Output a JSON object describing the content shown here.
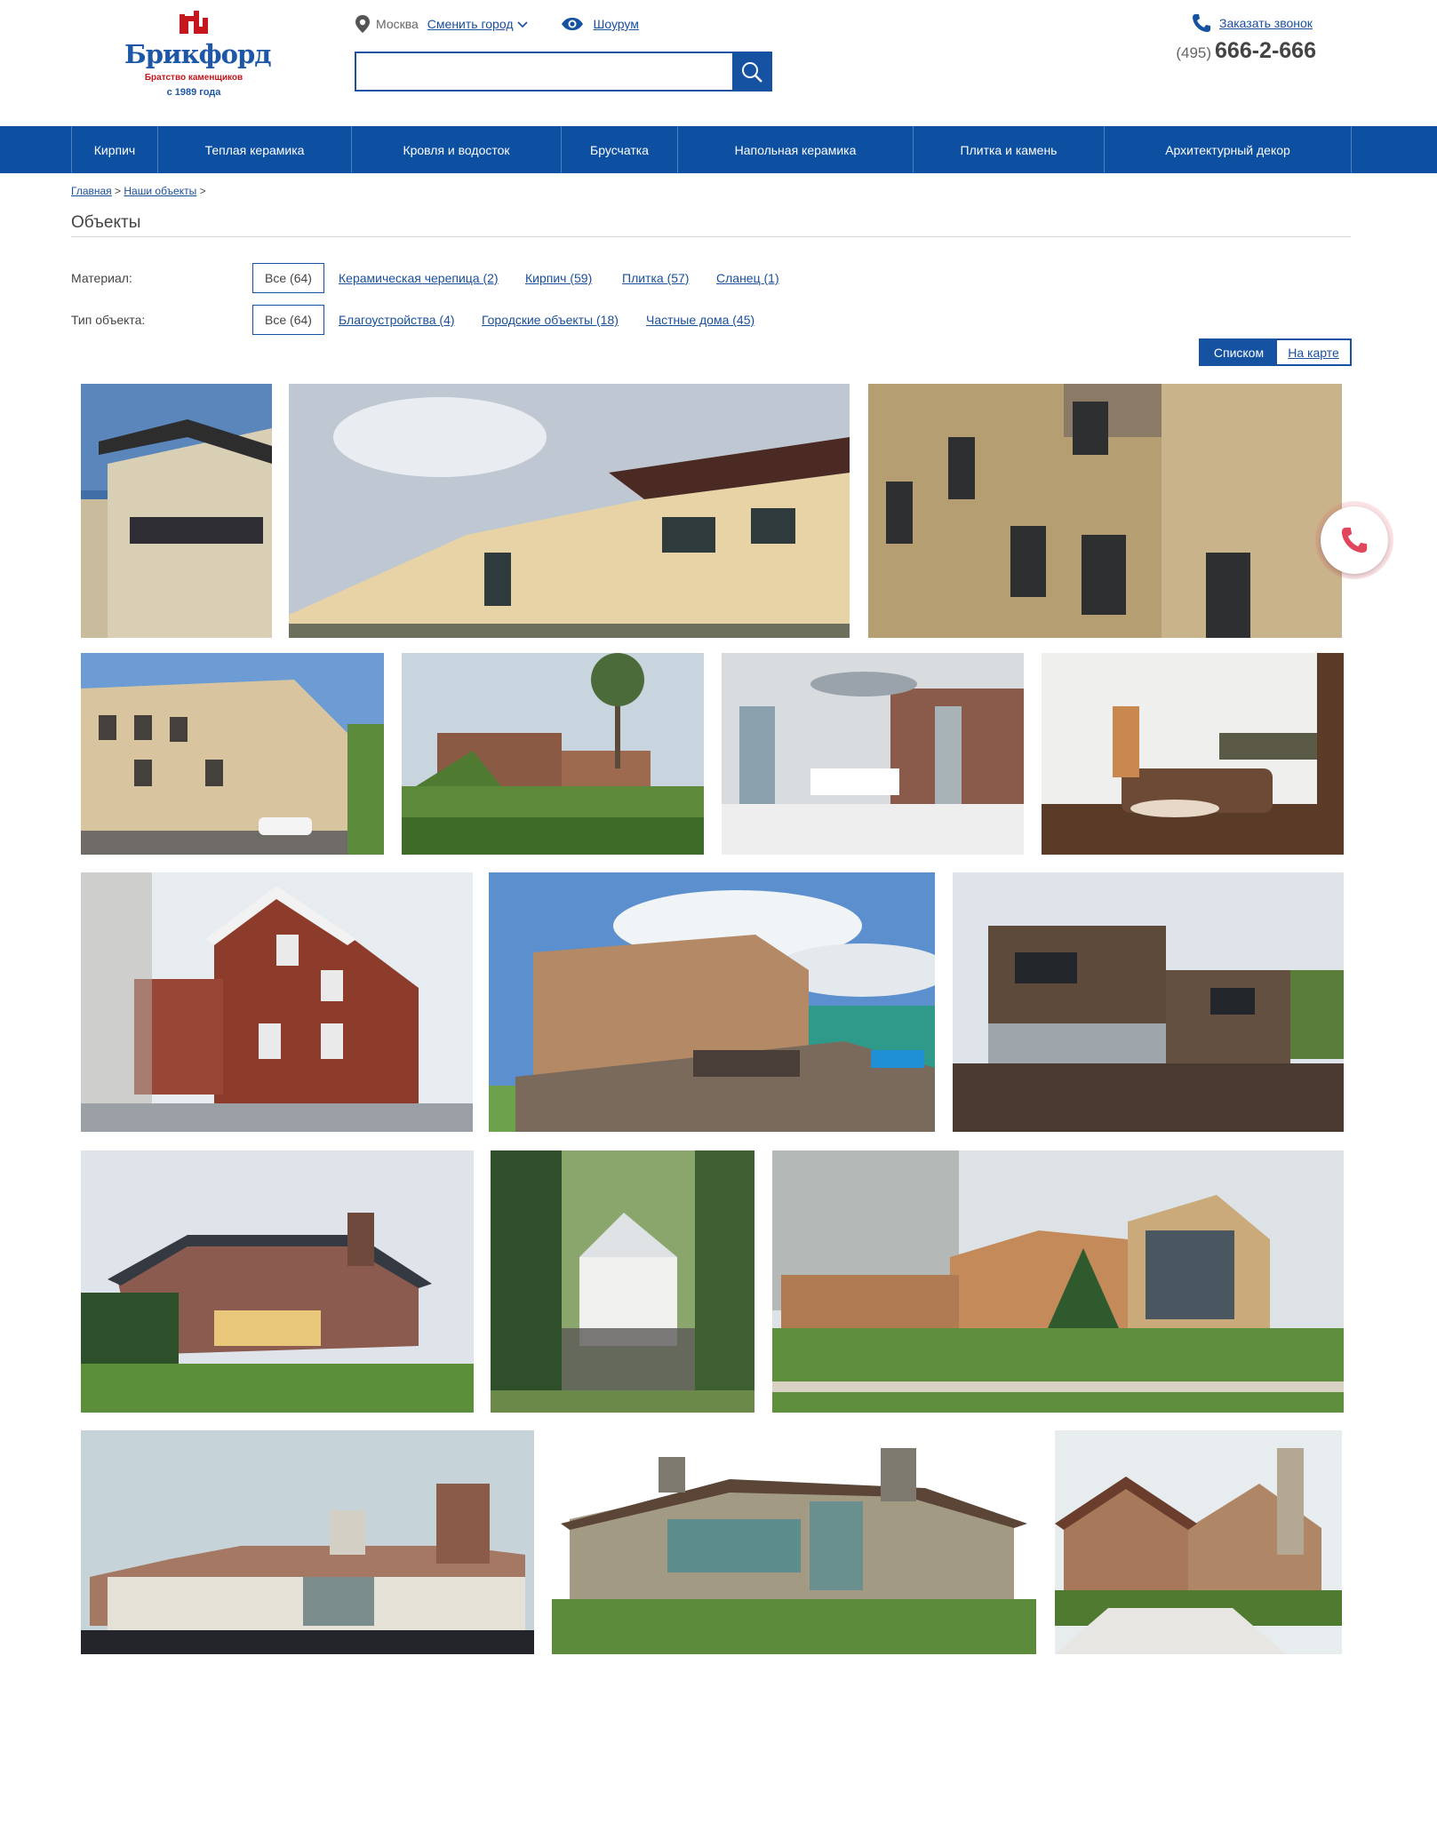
{
  "logo": {
    "name": "Брикфорд",
    "tagline": "Братство каменщиков",
    "since": "с 1989 года"
  },
  "header": {
    "city": "Москва",
    "change_city": "Сменить город",
    "showroom": "Шоурум",
    "search_placeholder": "",
    "callback": "Заказать звонок",
    "phone_code": "(495)",
    "phone_number": "666-2-666"
  },
  "nav": [
    "Кирпич",
    "Теплая керамика",
    "Кровля и водосток",
    "Брусчатка",
    "Напольная керамика",
    "Плитка и камень",
    "Архитектурный декор"
  ],
  "breadcrumb": {
    "home": "Главная",
    "sep": ">",
    "current": "Наши объекты"
  },
  "page_title": "Объекты",
  "filters": {
    "material": {
      "label": "Материал:",
      "selected": "Все (64)",
      "options": [
        "Керамическая черепица (2)",
        "Кирпич (59)",
        "Плитка (57)",
        "Сланец (1)"
      ]
    },
    "type": {
      "label": "Тип объекта:",
      "selected": "Все (64)",
      "options": [
        "Благоустройства (4)",
        "Городские объекты (18)",
        "Частные дома (45)"
      ]
    }
  },
  "view": {
    "list": "Списком",
    "map": "На карте"
  },
  "colors": {
    "brand": "#1552a2",
    "nav": "#0d50a2",
    "accent_red": "#c5161d",
    "call_widget": "#e0465c"
  },
  "icons": [
    "location-pin-icon",
    "chevron-down-icon",
    "eye-icon",
    "search-icon",
    "phone-icon"
  ]
}
